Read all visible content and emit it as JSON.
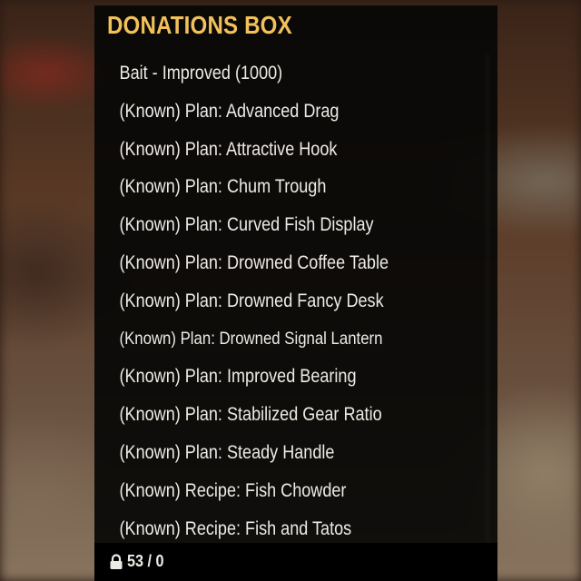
{
  "container": {
    "title": "DONATIONS BOX",
    "items": [
      {
        "label": "Bait - Improved (1000)"
      },
      {
        "label": "(Known)  Plan: Advanced Drag"
      },
      {
        "label": "(Known)  Plan: Attractive Hook"
      },
      {
        "label": "(Known)  Plan: Chum Trough"
      },
      {
        "label": "(Known)  Plan: Curved Fish Display"
      },
      {
        "label": "(Known)  Plan: Drowned Coffee Table"
      },
      {
        "label": "(Known)  Plan: Drowned Fancy Desk"
      },
      {
        "label": "(Known)  Plan: Drowned Signal Lantern"
      },
      {
        "label": "(Known)  Plan: Improved Bearing"
      },
      {
        "label": "(Known)  Plan: Stabilized Gear Ratio"
      },
      {
        "label": "(Known)  Plan: Steady Handle"
      },
      {
        "label": "(Known)  Recipe: Fish Chowder"
      },
      {
        "label": "(Known)  Recipe: Fish and Tatos"
      }
    ]
  },
  "footer": {
    "weight_icon": "lock-icon",
    "weight": "53 / 0"
  },
  "colors": {
    "title": "#f2c15a",
    "text": "#ecebe6",
    "panel": "#080806"
  }
}
